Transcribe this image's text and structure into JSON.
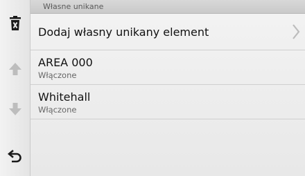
{
  "header": {
    "title": "Własne unikane"
  },
  "sidebar": {
    "items": [
      {
        "icon": "trash-x-icon"
      },
      {
        "icon": "arrow-up-icon"
      },
      {
        "icon": "arrow-down-icon"
      },
      {
        "icon": "back-icon"
      }
    ]
  },
  "list": {
    "items": [
      {
        "title": "Dodaj własny unikany element"
      },
      {
        "title": "AREA 000",
        "status": "Włączone"
      },
      {
        "title": "Whitehall",
        "status": "Włączone"
      }
    ]
  },
  "colors": {
    "background": "#e9e9e9",
    "header": "#cfcfcf",
    "text": "#111111",
    "muted_icon": "#b8b8b8"
  }
}
